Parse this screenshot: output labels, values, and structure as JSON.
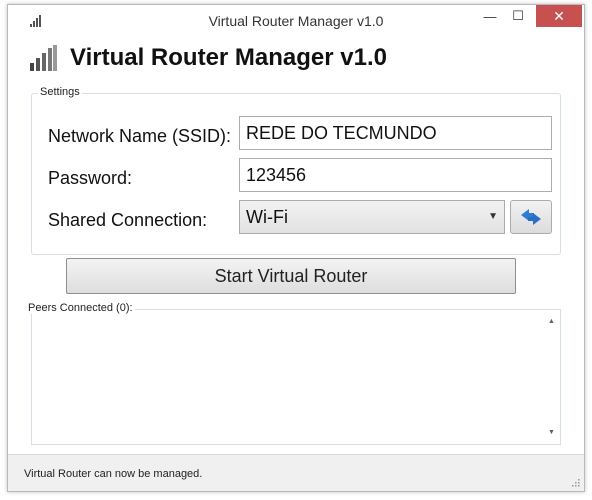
{
  "window": {
    "title": "Virtual Router Manager v1.0",
    "minimize_glyph": "—",
    "maximize_glyph": "☐",
    "close_glyph": "✕"
  },
  "header": {
    "title": "Virtual Router Manager v1.0"
  },
  "settings": {
    "group_label": "Settings",
    "ssid_label": "Network Name (SSID):",
    "ssid_value": "REDE DO TECMUNDO",
    "password_label": "Password:",
    "password_value": "123456",
    "shared_label": "Shared Connection:",
    "shared_selected": "Wi-Fi"
  },
  "actions": {
    "start_label": "Start Virtual Router"
  },
  "peers": {
    "label": "Peers Connected (0):",
    "items": []
  },
  "status": {
    "text": "Virtual Router can now be managed."
  },
  "colors": {
    "close_bg": "#c75050",
    "accent_blue": "#2f7cd6",
    "border": "#d5dfe5"
  },
  "icons": {
    "app": "router-signal-icon",
    "refresh": "refresh-icon"
  }
}
